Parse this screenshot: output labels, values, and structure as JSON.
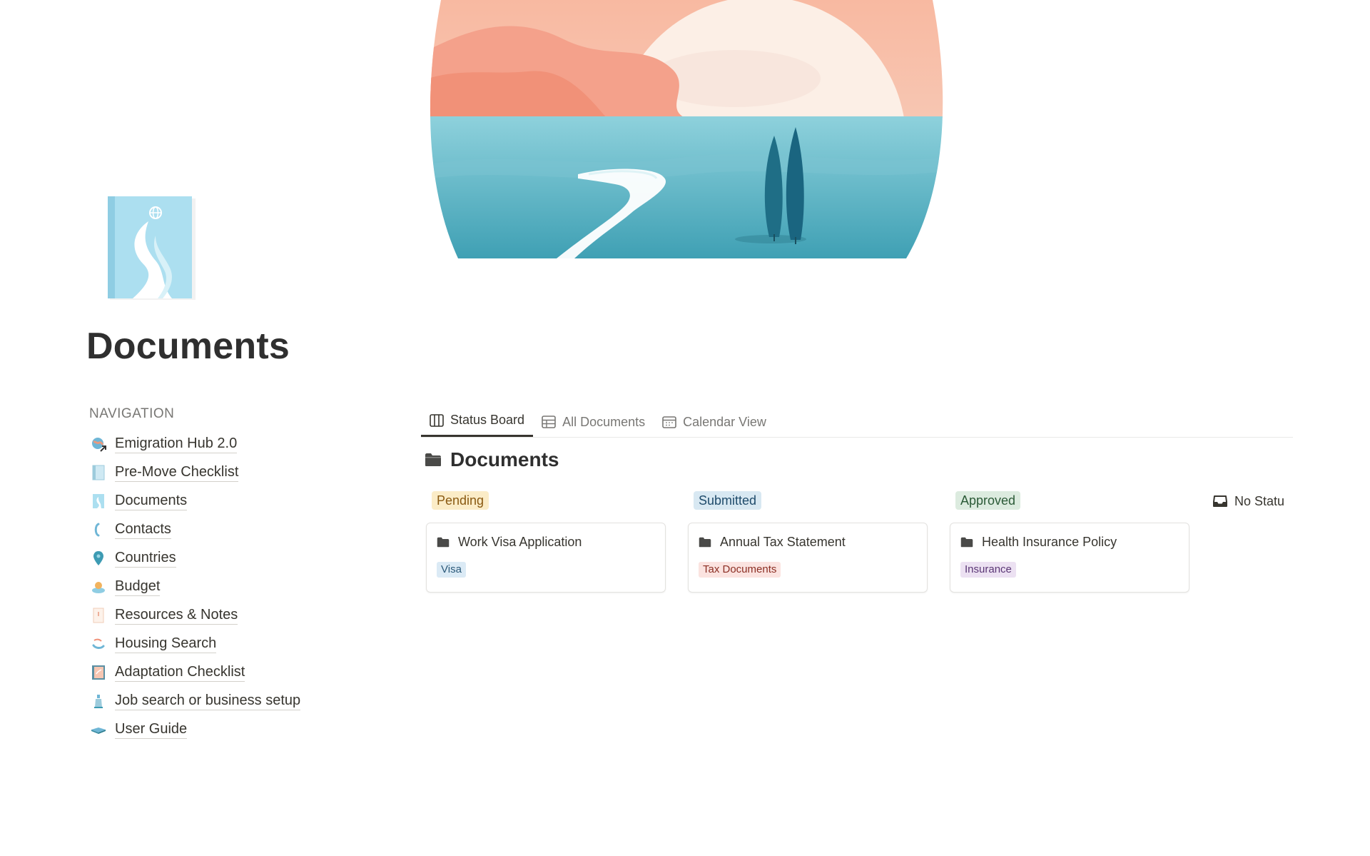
{
  "page": {
    "title": "Documents"
  },
  "navigation": {
    "heading": "NAVIGATION",
    "items": [
      {
        "label": "Emigration Hub 2.0",
        "icon": "globe-link-icon"
      },
      {
        "label": "Pre-Move Checklist",
        "icon": "book-icon"
      },
      {
        "label": "Documents",
        "icon": "path-book-icon"
      },
      {
        "label": "Contacts",
        "icon": "phone-icon"
      },
      {
        "label": "Countries",
        "icon": "map-pin-icon"
      },
      {
        "label": "Budget",
        "icon": "coin-stack-icon"
      },
      {
        "label": "Resources & Notes",
        "icon": "notes-icon"
      },
      {
        "label": "Housing Search",
        "icon": "house-icon"
      },
      {
        "label": "Adaptation Checklist",
        "icon": "checklist-book-icon"
      },
      {
        "label": "Job search or business setup",
        "icon": "bottle-icon"
      },
      {
        "label": "User Guide",
        "icon": "open-book-icon"
      }
    ]
  },
  "tabs": [
    {
      "label": "Status Board",
      "icon": "board-icon",
      "active": true
    },
    {
      "label": "All Documents",
      "icon": "table-icon",
      "active": false
    },
    {
      "label": "Calendar View",
      "icon": "calendar-icon",
      "active": false
    }
  ],
  "database": {
    "title": "Documents",
    "icon": "folder-icon"
  },
  "board": {
    "columns": [
      {
        "status": "Pending",
        "status_bg": "#fbecc7",
        "status_color": "#8a5a12",
        "cards": [
          {
            "title": "Work Visa Application",
            "tag": "Visa",
            "tag_bg": "#dbeaf5",
            "tag_color": "#2c5a7a"
          }
        ]
      },
      {
        "status": "Submitted",
        "status_bg": "#d8e8f2",
        "status_color": "#1f4b6b",
        "cards": [
          {
            "title": "Annual Tax Statement",
            "tag": "Tax Documents",
            "tag_bg": "#fbe3e0",
            "tag_color": "#8c2f24"
          }
        ]
      },
      {
        "status": "Approved",
        "status_bg": "#dcebdf",
        "status_color": "#2b5a37",
        "cards": [
          {
            "title": "Health Insurance Policy",
            "tag": "Insurance",
            "tag_bg": "#ece1f2",
            "tag_color": "#5b3776"
          }
        ]
      }
    ],
    "no_status_label": "No Statu"
  }
}
